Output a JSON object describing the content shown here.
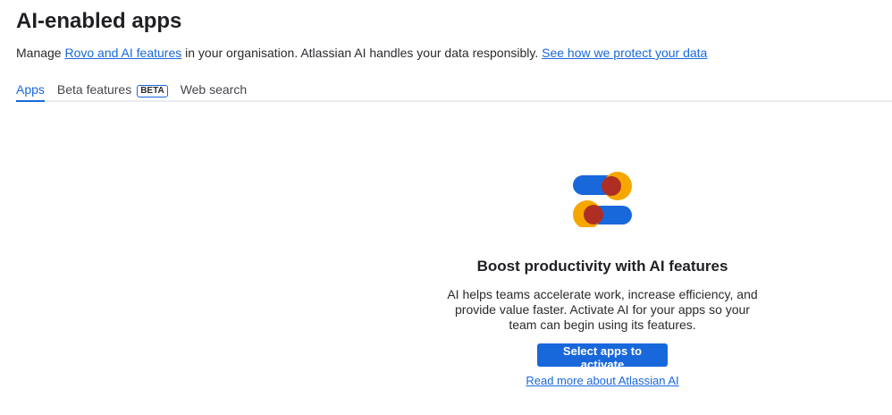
{
  "header": {
    "title": "AI-enabled apps",
    "desc_prefix": "Manage ",
    "desc_link1": "Rovo and AI features",
    "desc_mid": " in your organisation. Atlassian AI handles your data responsibly. ",
    "desc_link2": "See how we protect your data"
  },
  "tabs": [
    {
      "label": "Apps"
    },
    {
      "label": "Beta features",
      "badge": "BETA"
    },
    {
      "label": "Web search"
    }
  ],
  "empty_state": {
    "icon": "ai-toggle-illustration-icon",
    "title": "Boost productivity with AI features",
    "body": "AI helps teams accelerate work, increase efficiency, and provide value faster. Activate AI for your apps so your team can begin using its features.",
    "button": "Select apps to activate",
    "link": "Read more about Atlassian AI"
  }
}
